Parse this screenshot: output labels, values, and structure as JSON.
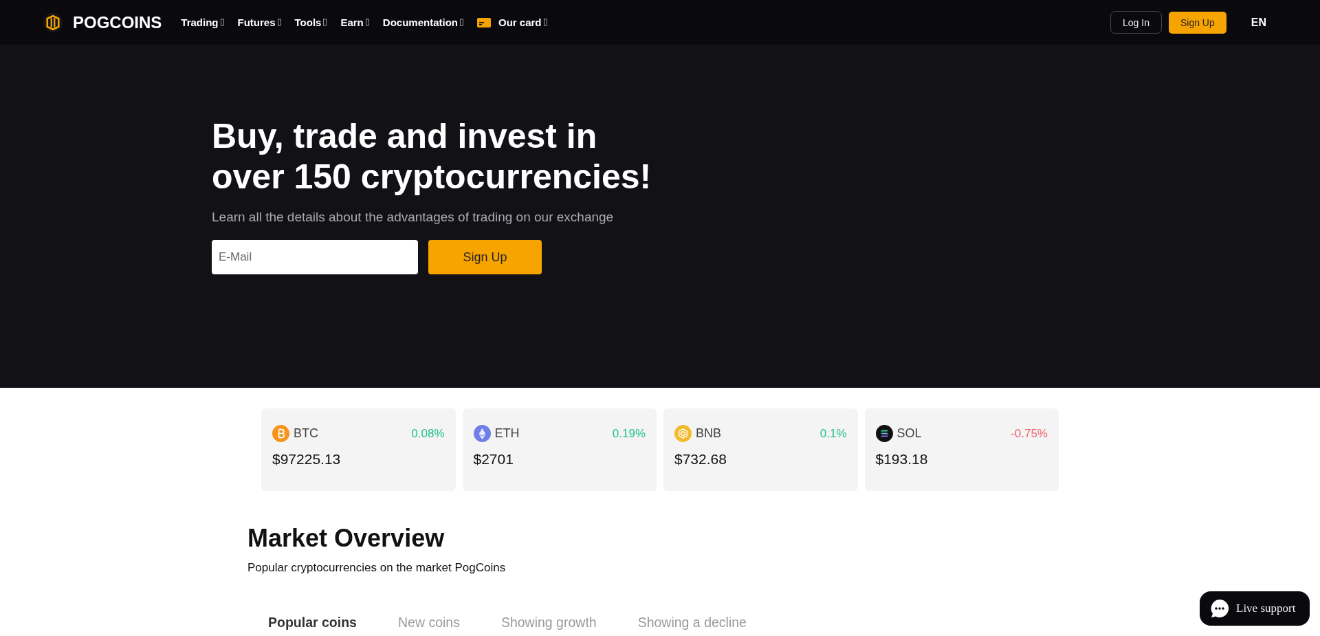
{
  "header": {
    "brand": "POGCOINS",
    "nav": [
      {
        "label": "Trading",
        "kind": "menu"
      },
      {
        "label": "Futures",
        "kind": "menu"
      },
      {
        "label": "Tools",
        "kind": "menu"
      },
      {
        "label": "Earn",
        "kind": "menu"
      },
      {
        "label": "Documentation",
        "kind": "menu"
      },
      {
        "label": "Our card",
        "kind": "card"
      }
    ],
    "login": "Log In",
    "signup": "Sign Up",
    "language": "EN"
  },
  "hero": {
    "title": "Buy, trade and invest in over 150 cryptocurrencies!",
    "subtitle": "Learn all the details about the advantages of trading on our exchange",
    "email": {
      "placeholder": "E-Mail"
    },
    "button": "Sign Up"
  },
  "tickers": [
    {
      "symbol": "BTC",
      "kind": "bitcoin",
      "change": "0.08%",
      "color": "#1fc28c",
      "price": "$97225.13"
    },
    {
      "symbol": "ETH",
      "kind": "ethereum",
      "change": "0.19%",
      "color": "#1fc28c",
      "price": "$2701"
    },
    {
      "symbol": "BNB",
      "kind": "bnb",
      "change": "0.1%",
      "color": "#1fc28c",
      "price": "$732.68"
    },
    {
      "symbol": "SOL",
      "kind": "solana",
      "change": "-0.75%",
      "color": "#f0646e",
      "price": "$193.18"
    }
  ],
  "market": {
    "title": "Market Overview",
    "subtitle": "Popular cryptocurrencies on the market PogCoins",
    "tabs": [
      {
        "label": "Popular coins",
        "selected": true
      },
      {
        "label": "New coins",
        "selected": false
      },
      {
        "label": "Showing growth",
        "selected": false
      },
      {
        "label": "Showing a decline",
        "selected": false
      }
    ]
  },
  "support": {
    "label": "Live support"
  }
}
